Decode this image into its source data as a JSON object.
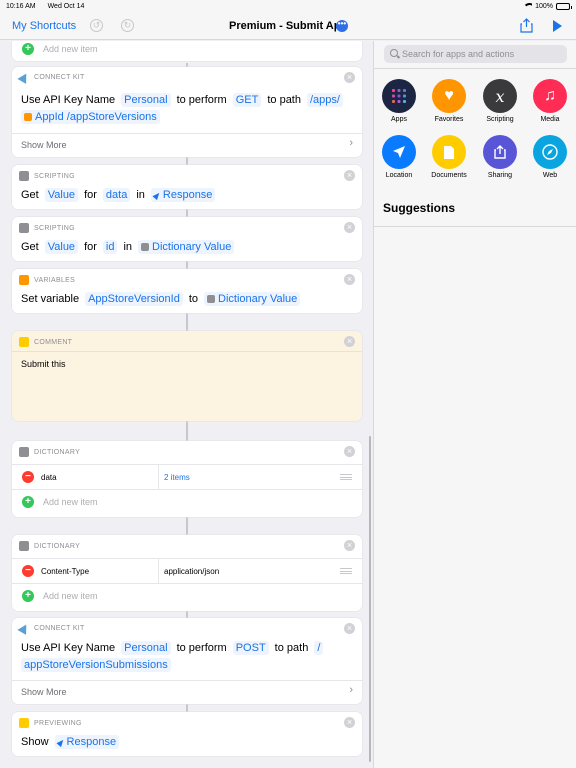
{
  "status": {
    "time": "10:16 AM",
    "date": "Wed Oct 14",
    "battery": "100%"
  },
  "nav": {
    "back": "My Shortcuts",
    "title": "Premium - Submit App",
    "more": "•••"
  },
  "top_add": "Add new item",
  "card1": {
    "header": "CONNECT KIT",
    "w1": "Use API Key Name",
    "tok1": "Personal",
    "w2": "to perform",
    "tok2": "GET",
    "w3": "to path",
    "tok3": "/apps/",
    "tok4": "AppId /appStoreVersions",
    "show_more": "Show More"
  },
  "card2": {
    "header": "SCRIPTING",
    "w1": "Get",
    "tok1": "Value",
    "w2": "for",
    "tok2": "data",
    "w3": "in",
    "tok3": "Response"
  },
  "card3": {
    "header": "SCRIPTING",
    "w1": "Get",
    "tok1": "Value",
    "w2": "for",
    "tok2": "id",
    "w3": "in",
    "tok3": "Dictionary Value"
  },
  "card4": {
    "header": "VARIABLES",
    "w1": "Set variable",
    "tok1": "AppStoreVersionId",
    "w2": "to",
    "tok2": "Dictionary Value"
  },
  "comment": {
    "header": "COMMENT",
    "text": "Submit this"
  },
  "dict1": {
    "header": "DICTIONARY",
    "key": "data",
    "value": "2 items",
    "add": "Add new item"
  },
  "dict2": {
    "header": "DICTIONARY",
    "key": "Content-Type",
    "value": "application/json",
    "add": "Add new item"
  },
  "card5": {
    "header": "CONNECT KIT",
    "w1": "Use API Key Name",
    "tok1": "Personal",
    "w2": "to perform",
    "tok2": "POST",
    "w3": "to path",
    "tok3": "/",
    "tok4": "appStoreVersionSubmissions",
    "show_more": "Show More"
  },
  "card6": {
    "header": "PREVIEWING",
    "w1": "Show",
    "tok1": "Response"
  },
  "panel": {
    "search_placeholder": "Search for apps and actions",
    "categories": [
      {
        "label": "Apps",
        "color": "#1c2541"
      },
      {
        "label": "Favorites",
        "color": "#ff9500"
      },
      {
        "label": "Scripting",
        "color": "#3a3a3c"
      },
      {
        "label": "Media",
        "color": "#ff2d55"
      },
      {
        "label": "Location",
        "color": "#0a7aff"
      },
      {
        "label": "Documents",
        "color": "#ffcc00"
      },
      {
        "label": "Sharing",
        "color": "#5856d6"
      },
      {
        "label": "Web",
        "color": "#0aa5e0"
      }
    ],
    "suggestions": "Suggestions"
  }
}
